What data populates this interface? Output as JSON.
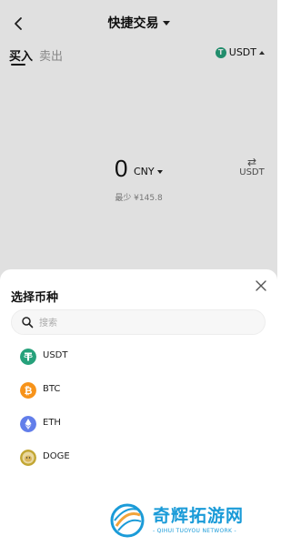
{
  "header": {
    "title": "快捷交易"
  },
  "tabs": {
    "buy": "买入",
    "sell": "卖出"
  },
  "coin_selector": {
    "label": "USDT",
    "icon_glyph": "T"
  },
  "amount": {
    "value": "0",
    "currency": "CNY",
    "min_text": "最少 ¥145.8"
  },
  "swap": {
    "label": "USDT"
  },
  "sheet": {
    "title": "选择币种",
    "search_placeholder": "搜索",
    "coins": [
      {
        "name": "USDT",
        "icon": "tether-icon",
        "color": "#26a17b",
        "glyph": "T"
      },
      {
        "name": "BTC",
        "icon": "bitcoin-icon",
        "color": "#f7931a",
        "glyph": "₿"
      },
      {
        "name": "ETH",
        "icon": "ethereum-icon",
        "color": "#627eea",
        "glyph": "◆"
      },
      {
        "name": "DOGE",
        "icon": "dogecoin-icon",
        "color": "#c2a633",
        "glyph": "Ð"
      }
    ]
  },
  "watermark": {
    "cn": "奇辉拓游网",
    "en": "- QIHUI TUOYOU NETWORK -"
  },
  "colors": {
    "accent": "#1a9bd8",
    "tether": "#26a17b"
  }
}
